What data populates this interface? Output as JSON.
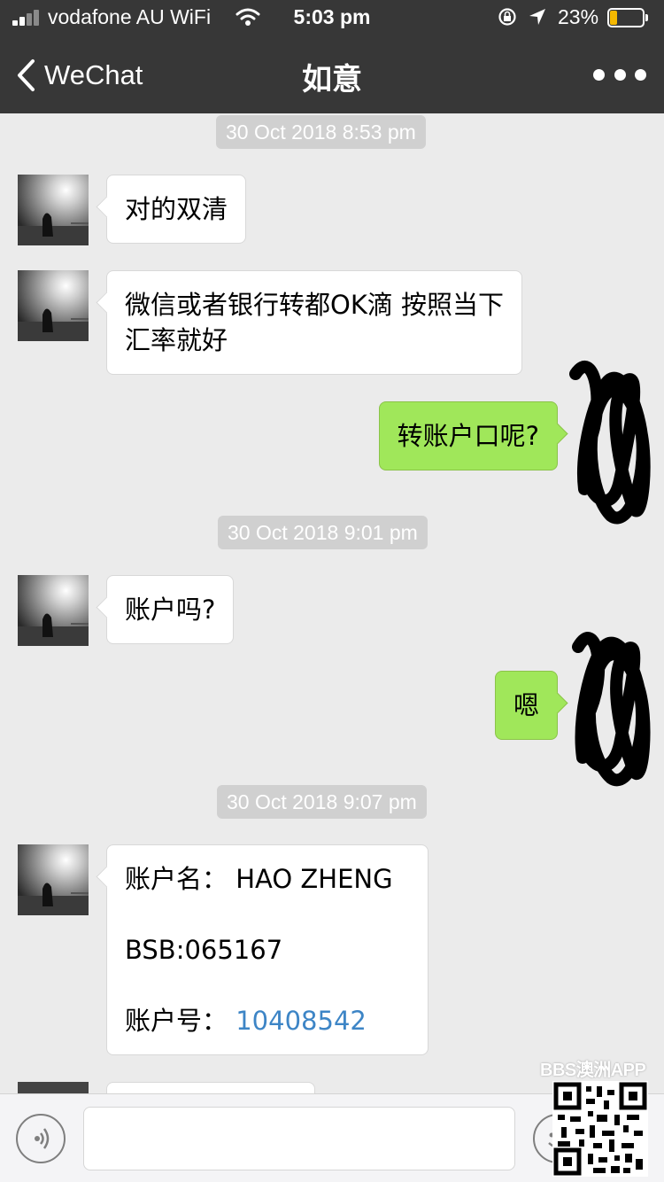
{
  "status_bar": {
    "carrier": "vodafone AU WiFi",
    "time": "5:03 pm",
    "battery_percent": "23%",
    "battery_level": 0.23,
    "battery_color": "#f5b800",
    "icons": [
      "signal-icon",
      "wifi-icon",
      "rotation-lock-icon",
      "location-icon",
      "battery-icon"
    ]
  },
  "nav": {
    "back_label": "WeChat",
    "title": "如意",
    "more_icon": "more-dots-icon"
  },
  "colors": {
    "header_bg": "#373737",
    "chat_bg": "#ebebeb",
    "incoming_bubble": "#ffffff",
    "outgoing_bubble": "#a0e75a",
    "timestamp_bg": "#d0d0d0",
    "link": "#3d85c6"
  },
  "timestamps": [
    "30 Oct 2018 8:53 pm",
    "30 Oct 2018 9:01 pm",
    "30 Oct 2018 9:07 pm"
  ],
  "messages": [
    {
      "side": "left",
      "text": "对的双清"
    },
    {
      "side": "left",
      "lines": [
        "微信或者银行转都OK滴 按照当下",
        "汇率就好"
      ]
    },
    {
      "side": "right",
      "text": "转账户口呢?"
    },
    {
      "side": "left",
      "text": "账户吗?"
    },
    {
      "side": "right",
      "text": "嗯"
    },
    {
      "side": "left",
      "account_name_label": "账户名：",
      "account_name": "HAO ZHENG",
      "bsb": "BSB:065167",
      "account_no_label": "账户号：",
      "account_no": "10408542"
    }
  ],
  "input_bar": {
    "voice_icon": "voice-icon",
    "emoji_icon": "emoji-icon"
  },
  "watermark": {
    "text": "BBS澳洲APP",
    "qr_icon": "qr-code-icon"
  }
}
